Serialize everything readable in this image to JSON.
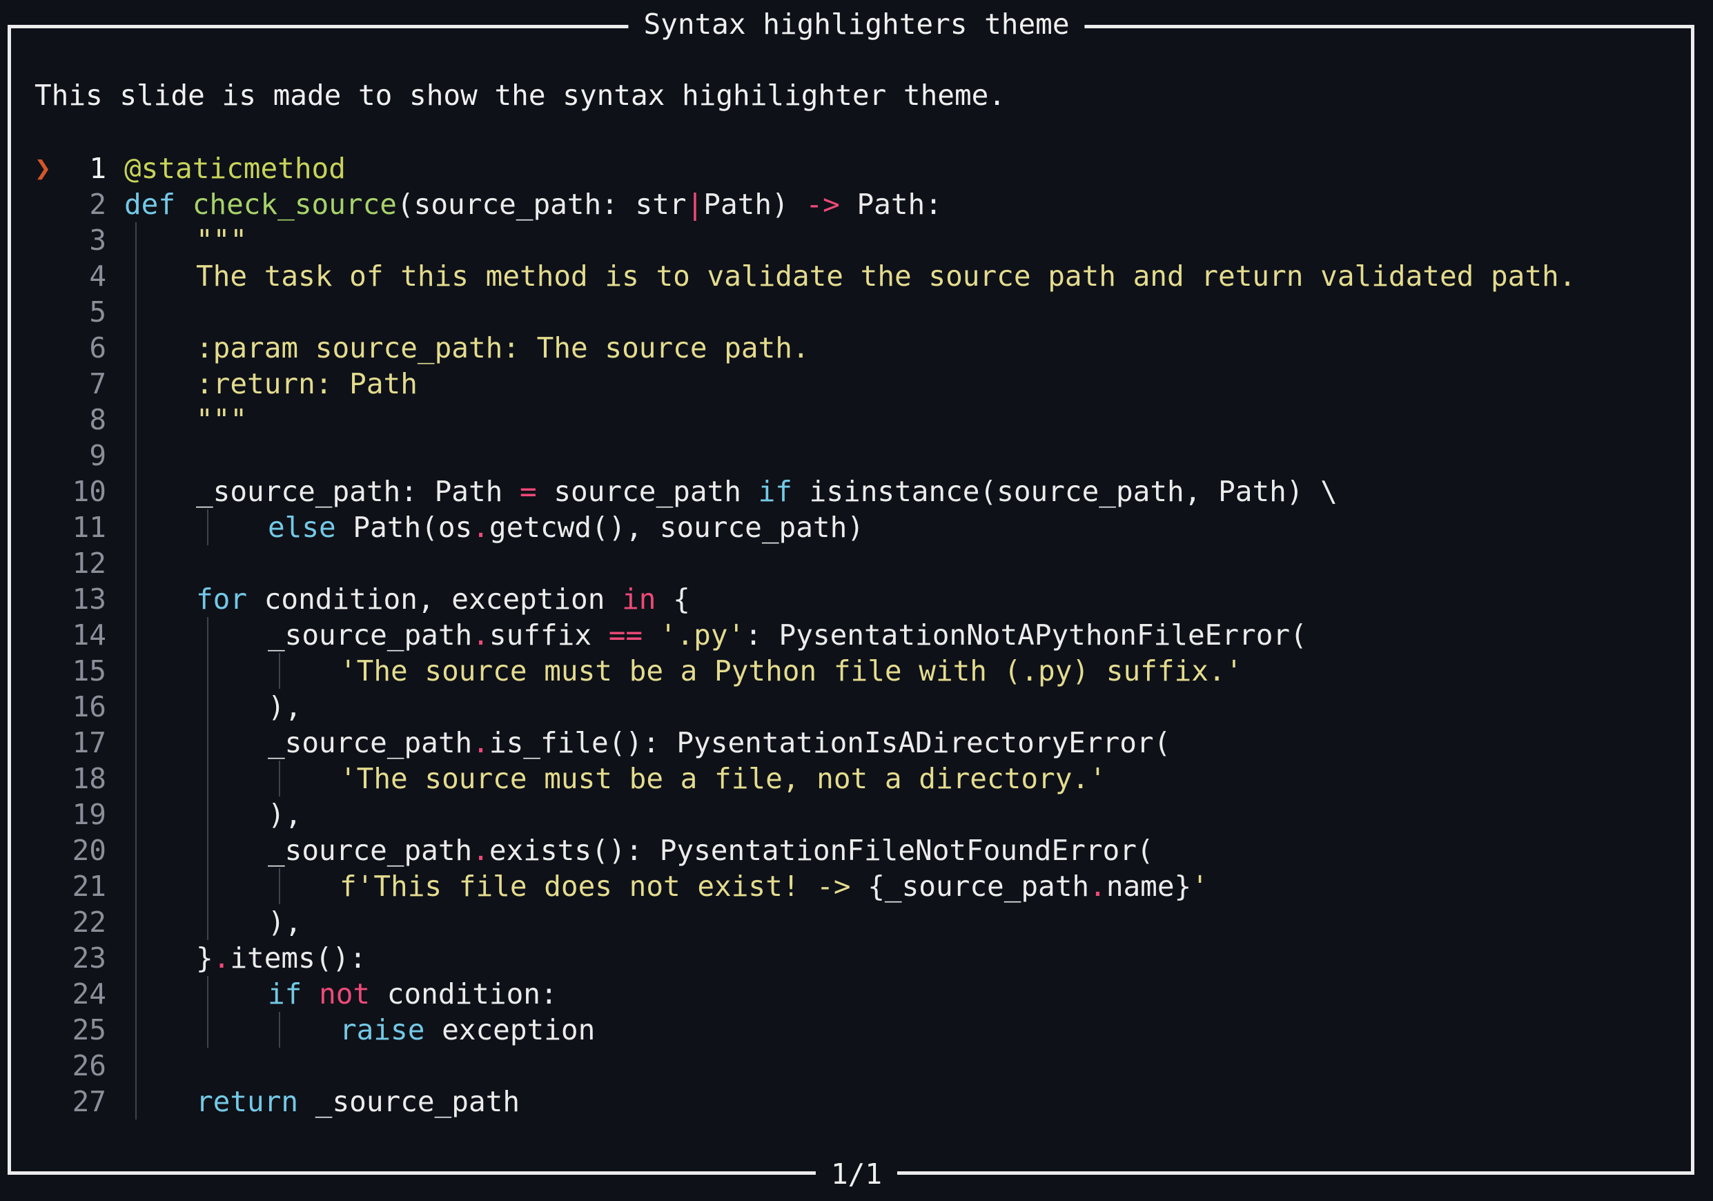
{
  "slide": {
    "title": "Syntax highlighters theme",
    "intro": "This slide is made to show the syntax highilighter theme.",
    "page_indicator": "1/1",
    "cursor_glyph": "❯"
  },
  "colors": {
    "background": "#0e1118",
    "decorator": "#c7d35a",
    "keyword": "#74c9e6",
    "function": "#a7d26a",
    "operator": "#ee4a78",
    "string": "#e4dc8e",
    "plain": "#ececec",
    "line_number": "#8a8f99",
    "cursor": "#d5562a"
  },
  "code": {
    "current_line": 1,
    "lines": [
      {
        "n": "1",
        "indent": 0,
        "guides": 0,
        "tokens": [
          [
            "dec",
            "@staticmethod"
          ]
        ]
      },
      {
        "n": "2",
        "indent": 0,
        "guides": 0,
        "tokens": [
          [
            "kw",
            "def "
          ],
          [
            "fn",
            "check_source"
          ],
          [
            "plain",
            "(source_path: str"
          ],
          [
            "op",
            "|"
          ],
          [
            "plain",
            "Path) "
          ],
          [
            "op",
            "->"
          ],
          [
            "plain",
            " Path:"
          ]
        ]
      },
      {
        "n": "3",
        "indent": 1,
        "guides": 1,
        "tokens": [
          [
            "str",
            "\"\"\""
          ]
        ]
      },
      {
        "n": "4",
        "indent": 1,
        "guides": 1,
        "tokens": [
          [
            "str",
            "The task of this method is to validate the source path and return validated path."
          ]
        ]
      },
      {
        "n": "5",
        "indent": 1,
        "guides": 1,
        "tokens": []
      },
      {
        "n": "6",
        "indent": 1,
        "guides": 1,
        "tokens": [
          [
            "str",
            ":param source_path: The source path."
          ]
        ]
      },
      {
        "n": "7",
        "indent": 1,
        "guides": 1,
        "tokens": [
          [
            "str",
            ":return: Path"
          ]
        ]
      },
      {
        "n": "8",
        "indent": 1,
        "guides": 1,
        "tokens": [
          [
            "str",
            "\"\"\""
          ]
        ]
      },
      {
        "n": "9",
        "indent": 1,
        "guides": 1,
        "tokens": []
      },
      {
        "n": "10",
        "indent": 1,
        "guides": 1,
        "tokens": [
          [
            "plain",
            "_source_path: Path "
          ],
          [
            "op",
            "="
          ],
          [
            "plain",
            " source_path "
          ],
          [
            "kw",
            "if"
          ],
          [
            "plain",
            " isinstance(source_path, Path) \\"
          ]
        ]
      },
      {
        "n": "11",
        "indent": 2,
        "guides": 2,
        "tokens": [
          [
            "kw",
            "else"
          ],
          [
            "plain",
            " Path(os"
          ],
          [
            "op",
            "."
          ],
          [
            "plain",
            "getcwd(), source_path)"
          ]
        ]
      },
      {
        "n": "12",
        "indent": 1,
        "guides": 1,
        "tokens": []
      },
      {
        "n": "13",
        "indent": 1,
        "guides": 1,
        "tokens": [
          [
            "kw",
            "for"
          ],
          [
            "plain",
            " condition, exception "
          ],
          [
            "op",
            "in"
          ],
          [
            "plain",
            " {"
          ]
        ]
      },
      {
        "n": "14",
        "indent": 2,
        "guides": 2,
        "tokens": [
          [
            "plain",
            "_source_path"
          ],
          [
            "op",
            "."
          ],
          [
            "plain",
            "suffix "
          ],
          [
            "op",
            "=="
          ],
          [
            "plain",
            " "
          ],
          [
            "str",
            "'.py'"
          ],
          [
            "plain",
            ": PysentationNotAPythonFileError("
          ]
        ]
      },
      {
        "n": "15",
        "indent": 3,
        "guides": 3,
        "tokens": [
          [
            "str",
            "'The source must be a Python file with (.py) suffix.'"
          ]
        ]
      },
      {
        "n": "16",
        "indent": 2,
        "guides": 2,
        "tokens": [
          [
            "plain",
            "),"
          ]
        ]
      },
      {
        "n": "17",
        "indent": 2,
        "guides": 2,
        "tokens": [
          [
            "plain",
            "_source_path"
          ],
          [
            "op",
            "."
          ],
          [
            "plain",
            "is_file(): PysentationIsADirectoryError("
          ]
        ]
      },
      {
        "n": "18",
        "indent": 3,
        "guides": 3,
        "tokens": [
          [
            "str",
            "'The source must be a file, not a directory.'"
          ]
        ]
      },
      {
        "n": "19",
        "indent": 2,
        "guides": 2,
        "tokens": [
          [
            "plain",
            "),"
          ]
        ]
      },
      {
        "n": "20",
        "indent": 2,
        "guides": 2,
        "tokens": [
          [
            "plain",
            "_source_path"
          ],
          [
            "op",
            "."
          ],
          [
            "plain",
            "exists(): PysentationFileNotFoundError("
          ]
        ]
      },
      {
        "n": "21",
        "indent": 3,
        "guides": 3,
        "tokens": [
          [
            "str",
            "f'This file does not exist! -> "
          ],
          [
            "plain",
            "{_source_path"
          ],
          [
            "op",
            "."
          ],
          [
            "plain",
            "name}"
          ],
          [
            "str",
            "'"
          ]
        ]
      },
      {
        "n": "22",
        "indent": 2,
        "guides": 2,
        "tokens": [
          [
            "plain",
            "),"
          ]
        ]
      },
      {
        "n": "23",
        "indent": 1,
        "guides": 1,
        "tokens": [
          [
            "plain",
            "}"
          ],
          [
            "op",
            "."
          ],
          [
            "plain",
            "items():"
          ]
        ]
      },
      {
        "n": "24",
        "indent": 2,
        "guides": 2,
        "tokens": [
          [
            "kw",
            "if"
          ],
          [
            "plain",
            " "
          ],
          [
            "op",
            "not"
          ],
          [
            "plain",
            " condition:"
          ]
        ]
      },
      {
        "n": "25",
        "indent": 3,
        "guides": 3,
        "tokens": [
          [
            "kw",
            "raise"
          ],
          [
            "plain",
            " exception"
          ]
        ]
      },
      {
        "n": "26",
        "indent": 1,
        "guides": 1,
        "tokens": []
      },
      {
        "n": "27",
        "indent": 1,
        "guides": 1,
        "tokens": [
          [
            "kw",
            "return"
          ],
          [
            "plain",
            " _source_path"
          ]
        ]
      }
    ]
  }
}
